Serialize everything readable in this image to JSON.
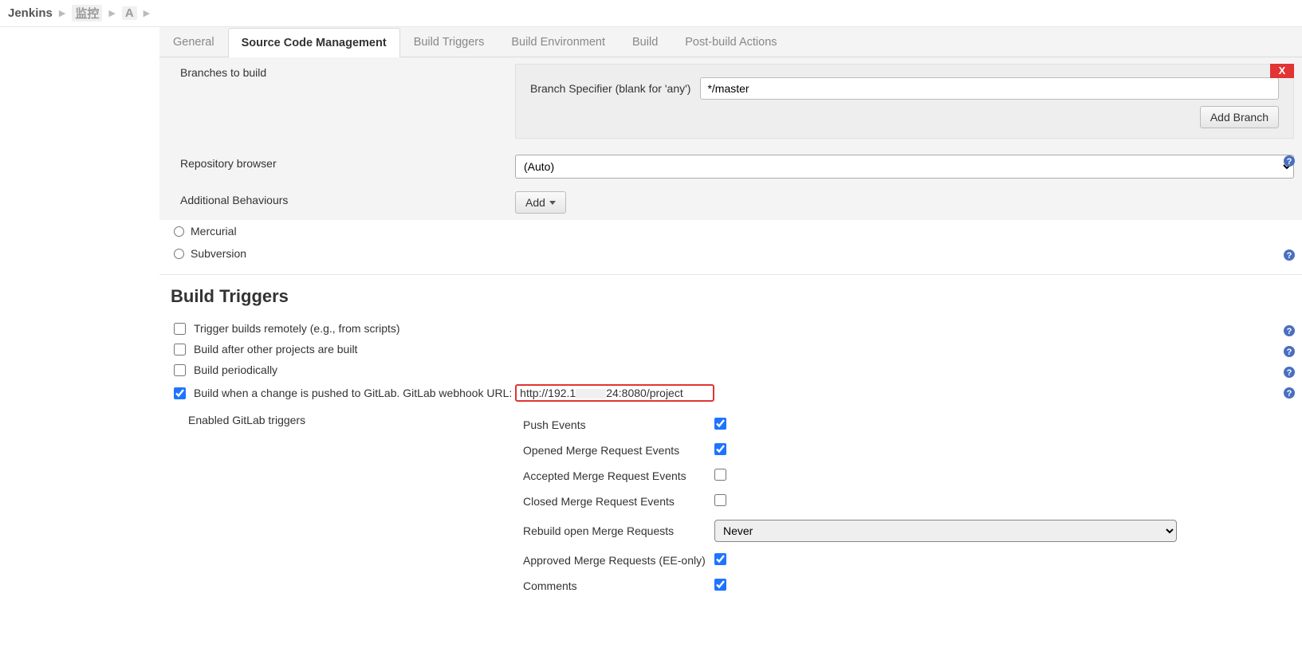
{
  "breadcrumb": {
    "root": "Jenkins",
    "job1": "    监控",
    "job2": "A   "
  },
  "tabs": {
    "general": "General",
    "scm": "Source Code Management",
    "triggers": "Build Triggers",
    "env": "Build Environment",
    "build": "Build",
    "post": "Post-build Actions"
  },
  "scm": {
    "branches_label": "Branches to build",
    "branch_specifier_label": "Branch Specifier (blank for 'any')",
    "branch_specifier_value": "*/master",
    "close_x": "X",
    "add_branch": "Add Branch",
    "repo_browser_label": "Repository browser",
    "repo_browser_value": "(Auto)",
    "additional_label": "Additional Behaviours",
    "add_btn": "Add",
    "mercurial": "Mercurial",
    "subversion": "Subversion"
  },
  "bt": {
    "heading": "Build Triggers",
    "remote": "Trigger builds remotely (e.g., from scripts)",
    "after": "Build after other projects are built",
    "periodic": "Build periodically",
    "gitlab_prefix": "Build when a change is pushed to GitLab. GitLab webhook URL:",
    "gitlab_url_a": "http://192.1",
    "gitlab_url_b": "24:8080/project",
    "enabled_label": "Enabled GitLab triggers",
    "opts": {
      "push": "Push Events",
      "opened": "Opened Merge Request Events",
      "accepted": "Accepted Merge Request Events",
      "closed": "Closed Merge Request Events",
      "rebuild": "Rebuild open Merge Requests",
      "rebuild_value": "Never",
      "approved": "Approved Merge Requests (EE-only)",
      "comments": "Comments"
    }
  }
}
